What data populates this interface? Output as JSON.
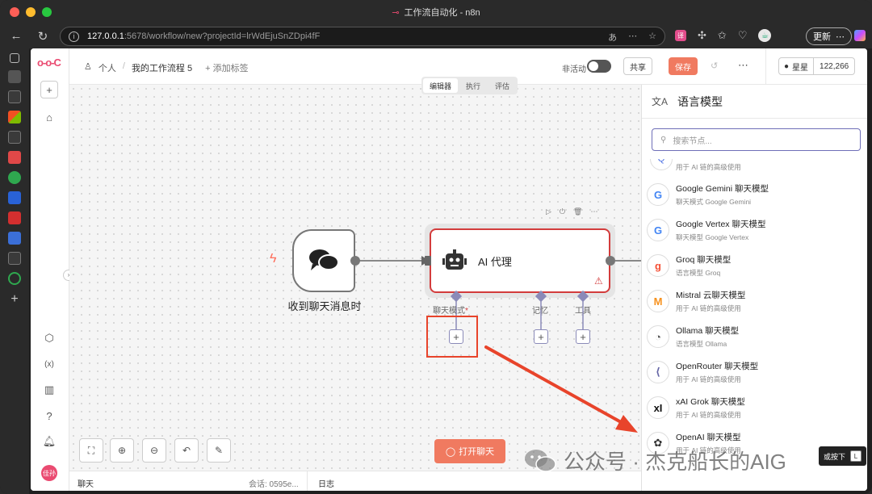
{
  "window": {
    "title": "工作流自动化 - n8n"
  },
  "address": {
    "host": "127.0.0.1",
    "path": ":5678/workflow/new?projectId=lrWdEjuSnZDpi4fF"
  },
  "browser": {
    "update_label": "更新"
  },
  "breadcrumb": {
    "project": "个人",
    "separator": "/",
    "workflow": "我的工作流程 5",
    "add_tag": "+ 添加标签"
  },
  "header": {
    "inactive_label": "非活动",
    "share_label": "共享",
    "save_label": "保存",
    "github_stars_label": "星星",
    "github_stars_count": "122,266"
  },
  "tabs": [
    {
      "label": "编辑器",
      "active": true
    },
    {
      "label": "执行",
      "active": false
    },
    {
      "label": "评估",
      "active": false
    }
  ],
  "canvas": {
    "trigger_label": "收到聊天消息时",
    "agent_title": "AI 代理",
    "sub_nodes": [
      {
        "label": "聊天模式",
        "required": "*"
      },
      {
        "label": "记忆",
        "required": ""
      },
      {
        "label": "工具",
        "required": ""
      }
    ],
    "open_chat_label": "打开聊天"
  },
  "bottom": {
    "chat_label": "聊天",
    "session_label": "会话: 0595e...",
    "logs_label": "日志"
  },
  "panel": {
    "title": "语言模型",
    "search_placeholder": "搜索节点...",
    "partial_desc": "用于 AI 链的高级使用",
    "items": [
      {
        "name": "Google Gemini 聊天模型",
        "desc": "聊天模式 Google Gemini",
        "icon": "G",
        "color": "#4285f4"
      },
      {
        "name": "Google Vertex 聊天模型",
        "desc": "聊天模型 Google Vertex",
        "icon": "G",
        "color": "#4285f4"
      },
      {
        "name": "Groq 聊天模型",
        "desc": "语言模型 Groq",
        "icon": "g",
        "color": "#f55036"
      },
      {
        "name": "Mistral 云聊天模型",
        "desc": "用于 AI 链的高级使用",
        "icon": "M",
        "color": "#f7911d"
      },
      {
        "name": "Ollama 聊天模型",
        "desc": "语言模型 Ollama",
        "icon": "◔",
        "color": "#555555"
      },
      {
        "name": "OpenRouter 聊天模型",
        "desc": "用于 AI 链的高级使用",
        "icon": "⟨",
        "color": "#6566a6"
      },
      {
        "name": "xAI Grok 聊天模型",
        "desc": "用于 AI 链的高级使用",
        "icon": "xI",
        "color": "#111111"
      },
      {
        "name": "OpenAI 聊天模型",
        "desc": "用于 AI 链的高级使用",
        "icon": "✿",
        "color": "#333333"
      }
    ]
  },
  "watermark": {
    "text": "公众号 · 杰克船长的AIG"
  },
  "tooltip": {
    "label": "或按下",
    "key": "L"
  },
  "colors": {
    "brand": "#ea4b71",
    "accent": "#f07a60",
    "error": "#d33c3c",
    "subnode": "#8a8ab8"
  }
}
